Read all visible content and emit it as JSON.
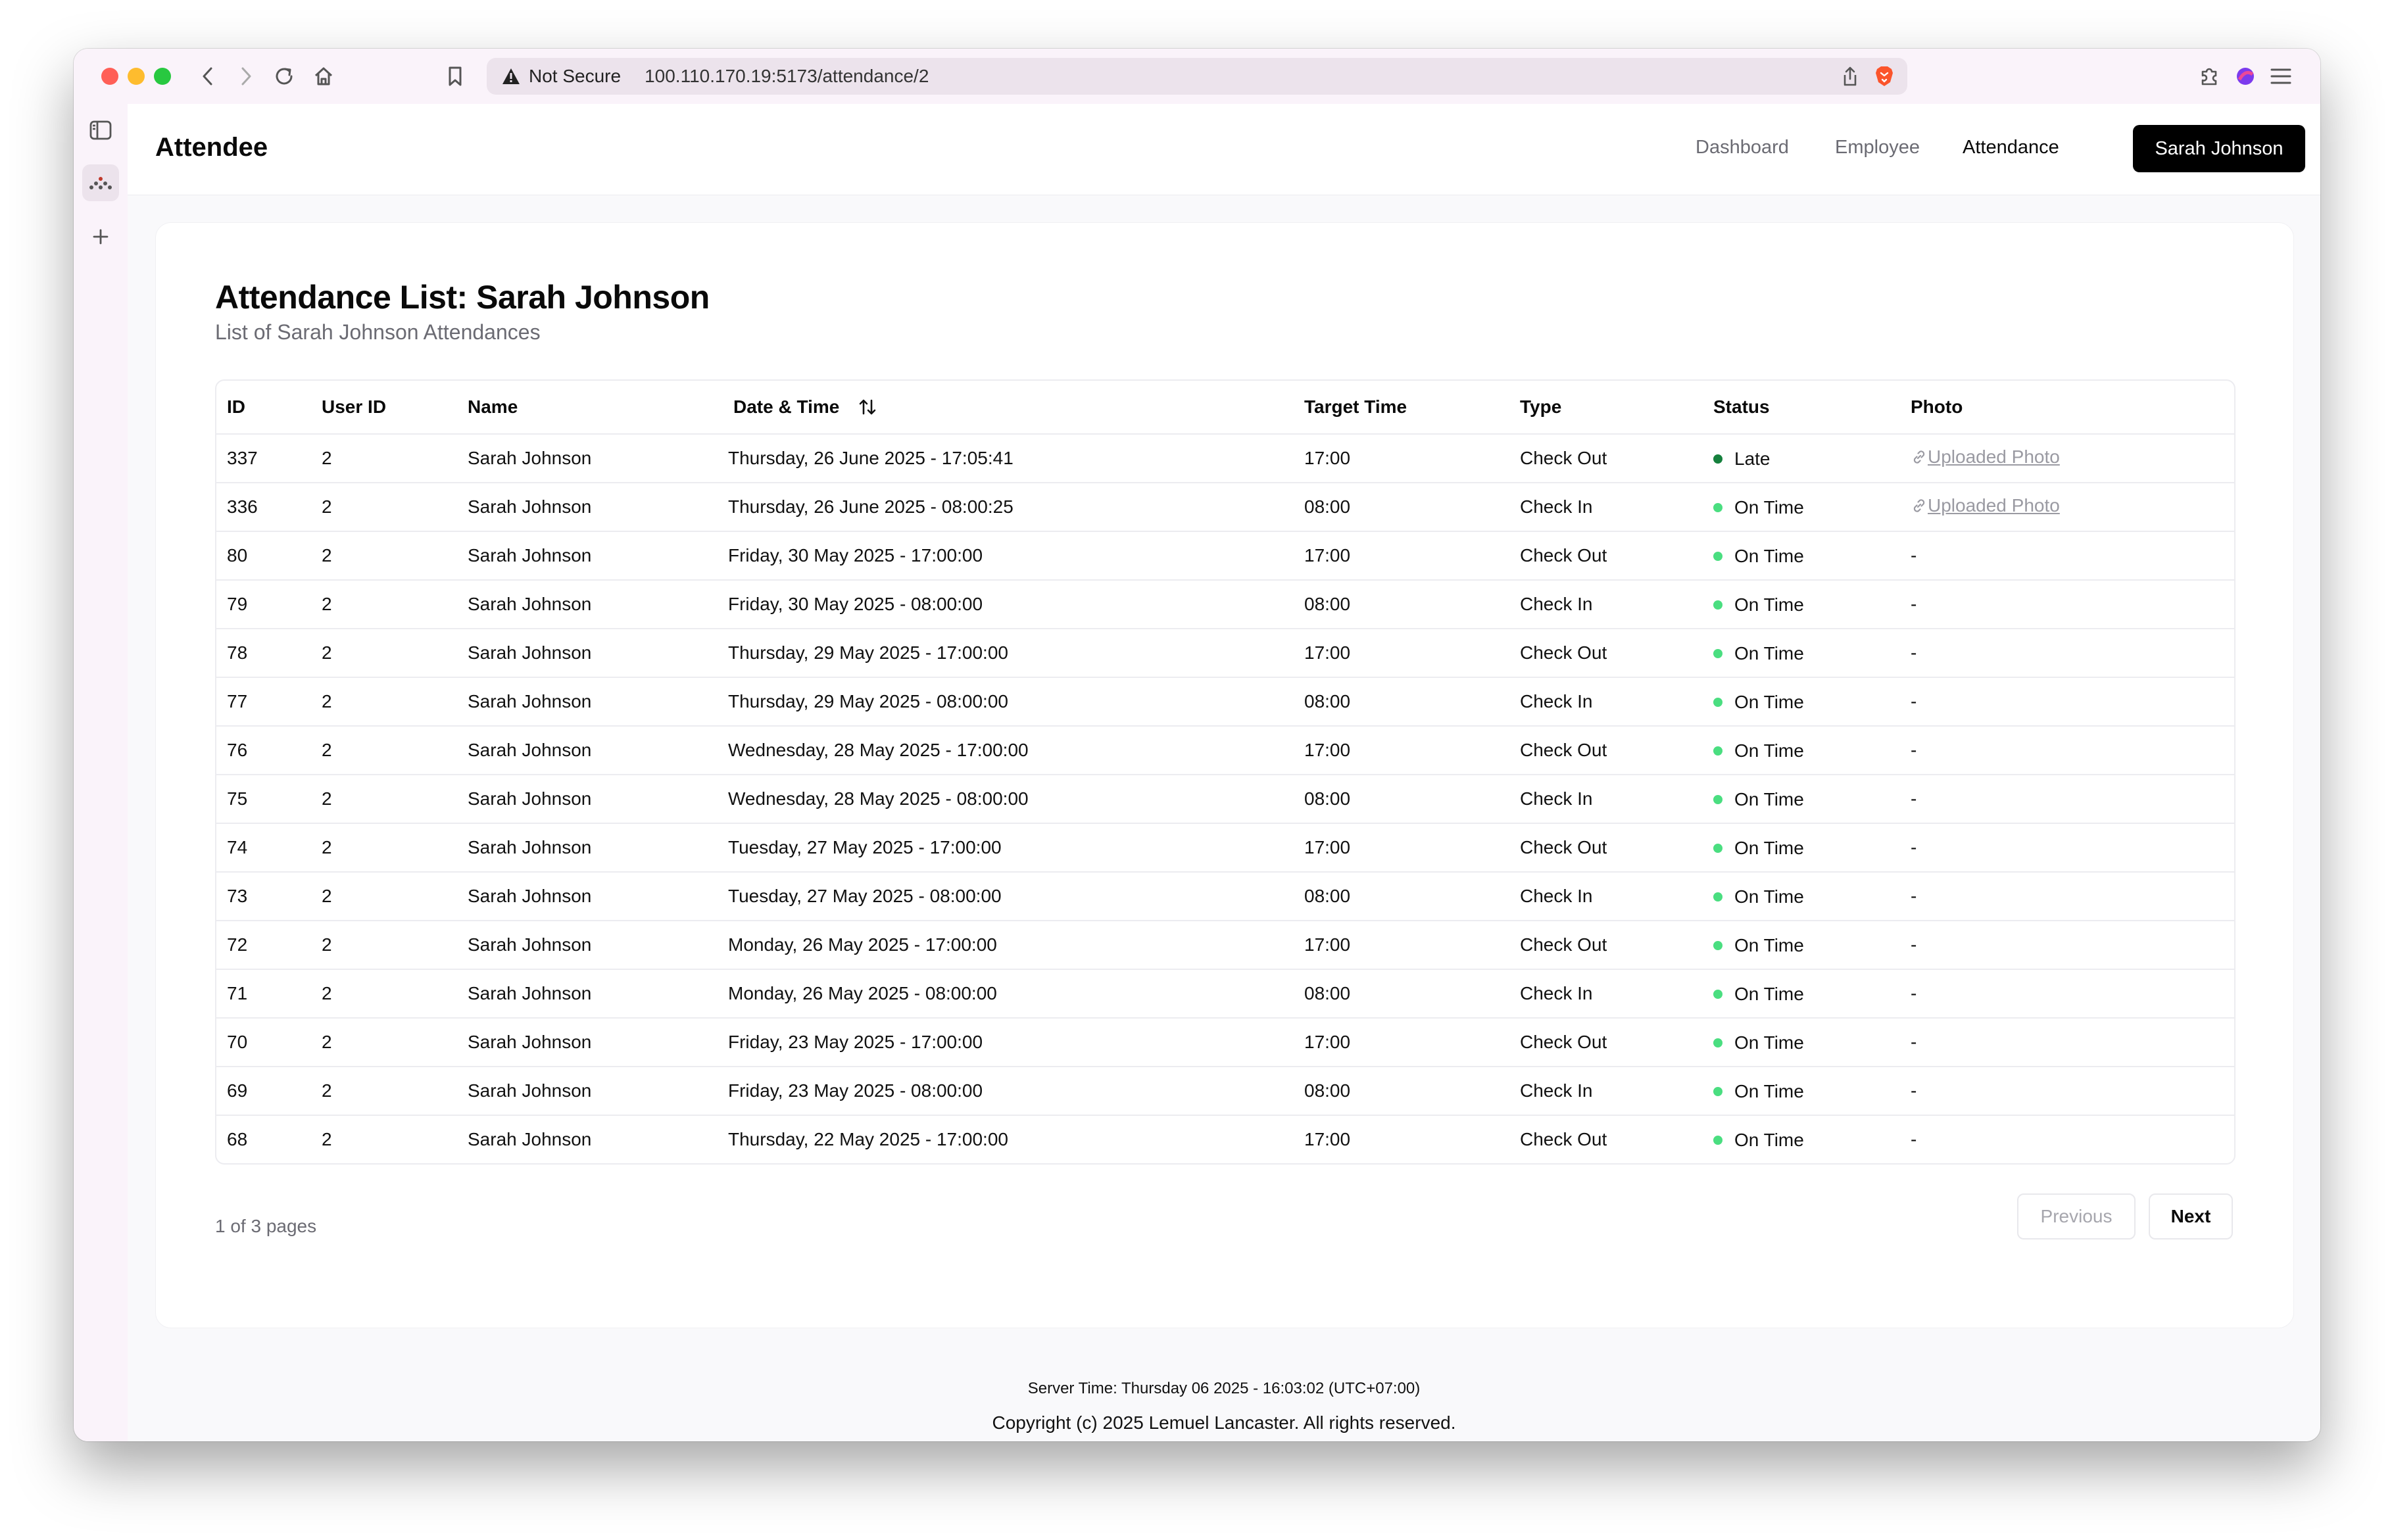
{
  "browser": {
    "security_label": "Not Secure",
    "url": "100.110.170.19:5173/attendance/2"
  },
  "app": {
    "brand": "Attendee",
    "nav": {
      "dashboard": "Dashboard",
      "employee": "Employee",
      "attendance": "Attendance"
    },
    "user_button": "Sarah Johnson"
  },
  "main": {
    "title": "Attendance List: Sarah Johnson",
    "subtitle": "List of Sarah Johnson Attendances",
    "columns": {
      "id": "ID",
      "user_id": "User ID",
      "name": "Name",
      "datetime": "Date & Time",
      "target": "Target Time",
      "type": "Type",
      "status": "Status",
      "photo": "Photo"
    },
    "rows": [
      {
        "id": "337",
        "user_id": "2",
        "name": "Sarah Johnson",
        "datetime": "Thursday, 26 June 2025 - 17:05:41",
        "target": "17:00",
        "type": "Check Out",
        "status": "Late",
        "photo": "Uploaded Photo"
      },
      {
        "id": "336",
        "user_id": "2",
        "name": "Sarah Johnson",
        "datetime": "Thursday, 26 June 2025 - 08:00:25",
        "target": "08:00",
        "type": "Check In",
        "status": "On Time",
        "photo": "Uploaded Photo"
      },
      {
        "id": "80",
        "user_id": "2",
        "name": "Sarah Johnson",
        "datetime": "Friday, 30 May 2025 - 17:00:00",
        "target": "17:00",
        "type": "Check Out",
        "status": "On Time",
        "photo": "-"
      },
      {
        "id": "79",
        "user_id": "2",
        "name": "Sarah Johnson",
        "datetime": "Friday, 30 May 2025 - 08:00:00",
        "target": "08:00",
        "type": "Check In",
        "status": "On Time",
        "photo": "-"
      },
      {
        "id": "78",
        "user_id": "2",
        "name": "Sarah Johnson",
        "datetime": "Thursday, 29 May 2025 - 17:00:00",
        "target": "17:00",
        "type": "Check Out",
        "status": "On Time",
        "photo": "-"
      },
      {
        "id": "77",
        "user_id": "2",
        "name": "Sarah Johnson",
        "datetime": "Thursday, 29 May 2025 - 08:00:00",
        "target": "08:00",
        "type": "Check In",
        "status": "On Time",
        "photo": "-"
      },
      {
        "id": "76",
        "user_id": "2",
        "name": "Sarah Johnson",
        "datetime": "Wednesday, 28 May 2025 - 17:00:00",
        "target": "17:00",
        "type": "Check Out",
        "status": "On Time",
        "photo": "-"
      },
      {
        "id": "75",
        "user_id": "2",
        "name": "Sarah Johnson",
        "datetime": "Wednesday, 28 May 2025 - 08:00:00",
        "target": "08:00",
        "type": "Check In",
        "status": "On Time",
        "photo": "-"
      },
      {
        "id": "74",
        "user_id": "2",
        "name": "Sarah Johnson",
        "datetime": "Tuesday, 27 May 2025 - 17:00:00",
        "target": "17:00",
        "type": "Check Out",
        "status": "On Time",
        "photo": "-"
      },
      {
        "id": "73",
        "user_id": "2",
        "name": "Sarah Johnson",
        "datetime": "Tuesday, 27 May 2025 - 08:00:00",
        "target": "08:00",
        "type": "Check In",
        "status": "On Time",
        "photo": "-"
      },
      {
        "id": "72",
        "user_id": "2",
        "name": "Sarah Johnson",
        "datetime": "Monday, 26 May 2025 - 17:00:00",
        "target": "17:00",
        "type": "Check Out",
        "status": "On Time",
        "photo": "-"
      },
      {
        "id": "71",
        "user_id": "2",
        "name": "Sarah Johnson",
        "datetime": "Monday, 26 May 2025 - 08:00:00",
        "target": "08:00",
        "type": "Check In",
        "status": "On Time",
        "photo": "-"
      },
      {
        "id": "70",
        "user_id": "2",
        "name": "Sarah Johnson",
        "datetime": "Friday, 23 May 2025 - 17:00:00",
        "target": "17:00",
        "type": "Check Out",
        "status": "On Time",
        "photo": "-"
      },
      {
        "id": "69",
        "user_id": "2",
        "name": "Sarah Johnson",
        "datetime": "Friday, 23 May 2025 - 08:00:00",
        "target": "08:00",
        "type": "Check In",
        "status": "On Time",
        "photo": "-"
      },
      {
        "id": "68",
        "user_id": "2",
        "name": "Sarah Johnson",
        "datetime": "Thursday, 22 May 2025 - 17:00:00",
        "target": "17:00",
        "type": "Check Out",
        "status": "On Time",
        "photo": "-"
      }
    ],
    "status_colors": {
      "Late": "#15803d",
      "On Time": "#4ade80"
    }
  },
  "pagination": {
    "info": "1 of 3 pages",
    "previous": "Previous",
    "next": "Next"
  },
  "footer": {
    "server_time": "Server Time: Thursday 06 2025 - 16:03:02 (UTC+07:00)",
    "copyright": "Copyright (c) 2025 Lemuel Lancaster. All rights reserved."
  },
  "icons": {
    "sort": "sort-arrows-icon",
    "link": "link-icon",
    "warning": "warning-icon",
    "brave": "brave-lion-icon",
    "share": "share-icon",
    "extensions": "puzzle-icon"
  }
}
